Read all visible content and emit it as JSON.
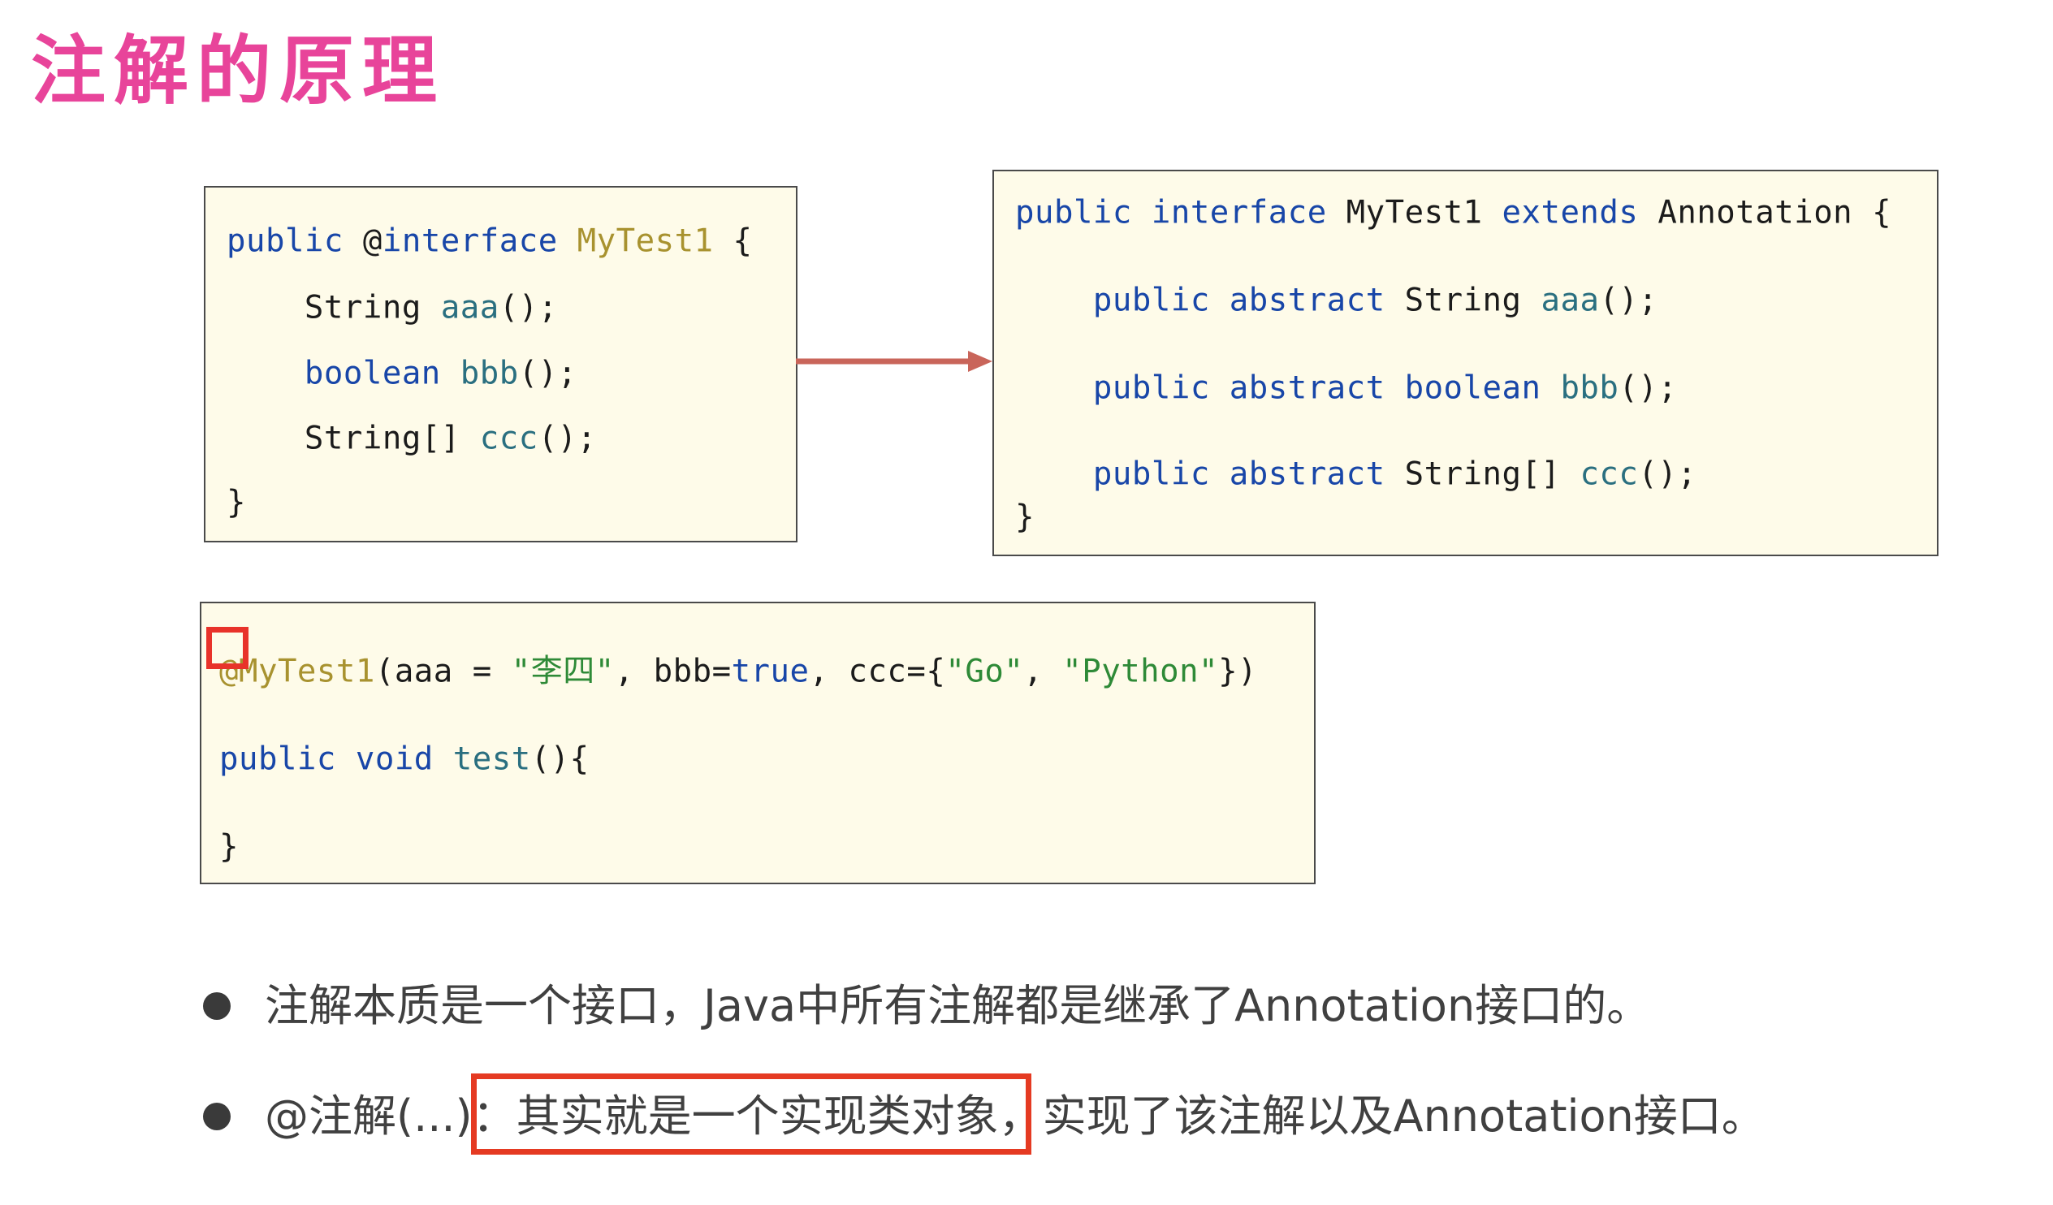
{
  "title": "注解的原理",
  "box_definition": {
    "lines": [
      [
        {
          "t": "public ",
          "c": "kw"
        },
        {
          "t": "@",
          "c": "plain"
        },
        {
          "t": "interface",
          "c": "kw"
        },
        {
          "t": " ",
          "c": "plain"
        },
        {
          "t": "MyTest1",
          "c": "ann"
        },
        {
          "t": " {",
          "c": "plain"
        }
      ],
      [
        {
          "t": "    String ",
          "c": "plain"
        },
        {
          "t": "aaa",
          "c": "meth"
        },
        {
          "t": "();",
          "c": "plain"
        }
      ],
      [
        {
          "t": "    boolean",
          "c": "kw"
        },
        {
          "t": " ",
          "c": "plain"
        },
        {
          "t": "bbb",
          "c": "meth"
        },
        {
          "t": "();",
          "c": "plain"
        }
      ],
      [
        {
          "t": "    String[] ",
          "c": "plain"
        },
        {
          "t": "ccc",
          "c": "meth"
        },
        {
          "t": "();",
          "c": "plain"
        }
      ],
      [
        {
          "t": "}",
          "c": "plain"
        }
      ]
    ]
  },
  "box_compiled": {
    "lines": [
      [
        {
          "t": "public interface ",
          "c": "kw"
        },
        {
          "t": "MyTest1 ",
          "c": "plain"
        },
        {
          "t": "extends ",
          "c": "kw"
        },
        {
          "t": "Annotation {",
          "c": "plain"
        }
      ],
      [
        {
          "t": "    public abstract ",
          "c": "kw"
        },
        {
          "t": "String ",
          "c": "plain"
        },
        {
          "t": "aaa",
          "c": "meth"
        },
        {
          "t": "();",
          "c": "plain"
        }
      ],
      [
        {
          "t": "    public abstract boolean ",
          "c": "kw"
        },
        {
          "t": "bbb",
          "c": "meth"
        },
        {
          "t": "();",
          "c": "plain"
        }
      ],
      [
        {
          "t": "    public abstract ",
          "c": "kw"
        },
        {
          "t": "String[] ",
          "c": "plain"
        },
        {
          "t": "ccc",
          "c": "meth"
        },
        {
          "t": "();",
          "c": "plain"
        }
      ],
      [
        {
          "t": "}",
          "c": "plain"
        }
      ]
    ]
  },
  "box_usage": {
    "lines": [
      [
        {
          "t": "@MyTest1",
          "c": "ann"
        },
        {
          "t": "(aaa = ",
          "c": "plain"
        },
        {
          "t": "\"李四\"",
          "c": "str"
        },
        {
          "t": ", bbb=",
          "c": "plain"
        },
        {
          "t": "true",
          "c": "kw"
        },
        {
          "t": ", ccc={",
          "c": "plain"
        },
        {
          "t": "\"Go\"",
          "c": "str"
        },
        {
          "t": ", ",
          "c": "plain"
        },
        {
          "t": "\"Python\"",
          "c": "str"
        },
        {
          "t": "})",
          "c": "plain"
        }
      ],
      [
        {
          "t": "public void ",
          "c": "kw"
        },
        {
          "t": "test",
          "c": "meth"
        },
        {
          "t": "(){",
          "c": "plain"
        }
      ],
      [
        {
          "t": "}",
          "c": "plain"
        }
      ]
    ]
  },
  "bullets": [
    {
      "text": "注解本质是一个接口，Java中所有注解都是继承了Annotation接口的。"
    },
    {
      "prefix": "@注解(...)",
      "highlight": "：其实就是一个实现类对象",
      "suffix": "，实现了该注解以及Annotation接口。"
    }
  ],
  "colors": {
    "title": "#e8449a",
    "code_background": "#fefbe9",
    "keyword": "#1846a8",
    "annotation": "#a8922f",
    "method": "#2a6f80",
    "string": "#2e8a37",
    "arrow": "#c9655a",
    "highlight_border": "#e53a22"
  }
}
